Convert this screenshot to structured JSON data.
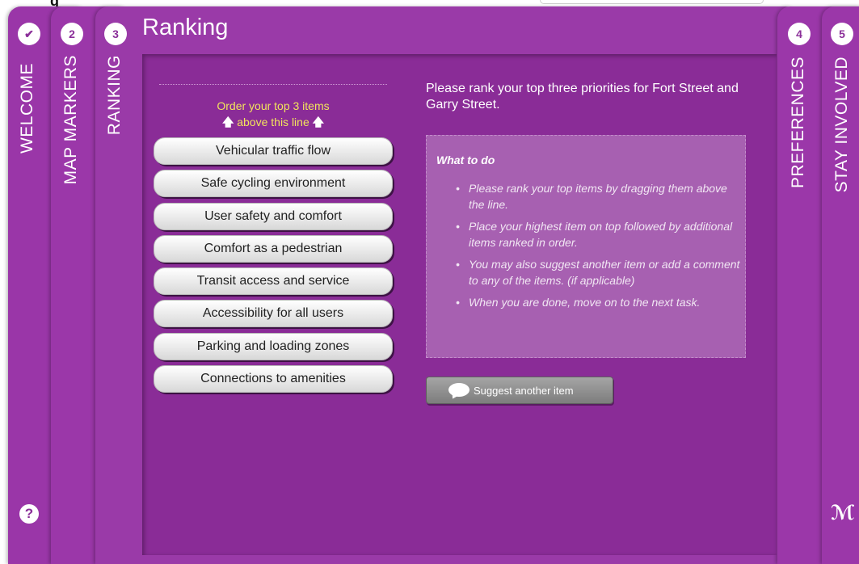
{
  "tabs": [
    {
      "number": "✔",
      "label": "WELCOME"
    },
    {
      "number": "2",
      "label": "MAP MARKERS"
    },
    {
      "number": "3",
      "label": "RANKING"
    },
    {
      "number": "4",
      "label": "PREFERENCES"
    },
    {
      "number": "5",
      "label": "STAY INVOLVED"
    }
  ],
  "page_title": "Ranking",
  "instructions": {
    "order_line1": "Order your top 3 items",
    "order_line2": "above this line",
    "arrow": "🡅"
  },
  "rank_items": [
    "Vehicular traffic flow",
    "Safe cycling environment",
    "User safety and comfort",
    "Comfort as a pedestrian",
    "Transit access and service",
    "Accessibility for all users",
    "Parking and loading zones",
    "Connections to amenities"
  ],
  "intro_text": "Please rank your top three priorities for Fort Street and Garry Street.",
  "what_to_do": {
    "title": "What to do",
    "items": [
      "Please rank your top items by dragging them above the line.",
      "Place your highest item on top followed by additional items ranked in order.",
      "You may also suggest another item or add a comment to any of the items. (if applicable)",
      "When you are done, move on to the next task."
    ]
  },
  "suggest_button": "Suggest another item",
  "help": "?",
  "top_partial_text": "g",
  "colors": {
    "tab_purple": "#9b37a9",
    "content_purple": "#8a2c97",
    "accent_yellow": "#f2e45c"
  },
  "icons": [
    "check-icon",
    "arrow-up-icon",
    "speech-bubble-icon",
    "help-icon",
    "logo-icon"
  ]
}
